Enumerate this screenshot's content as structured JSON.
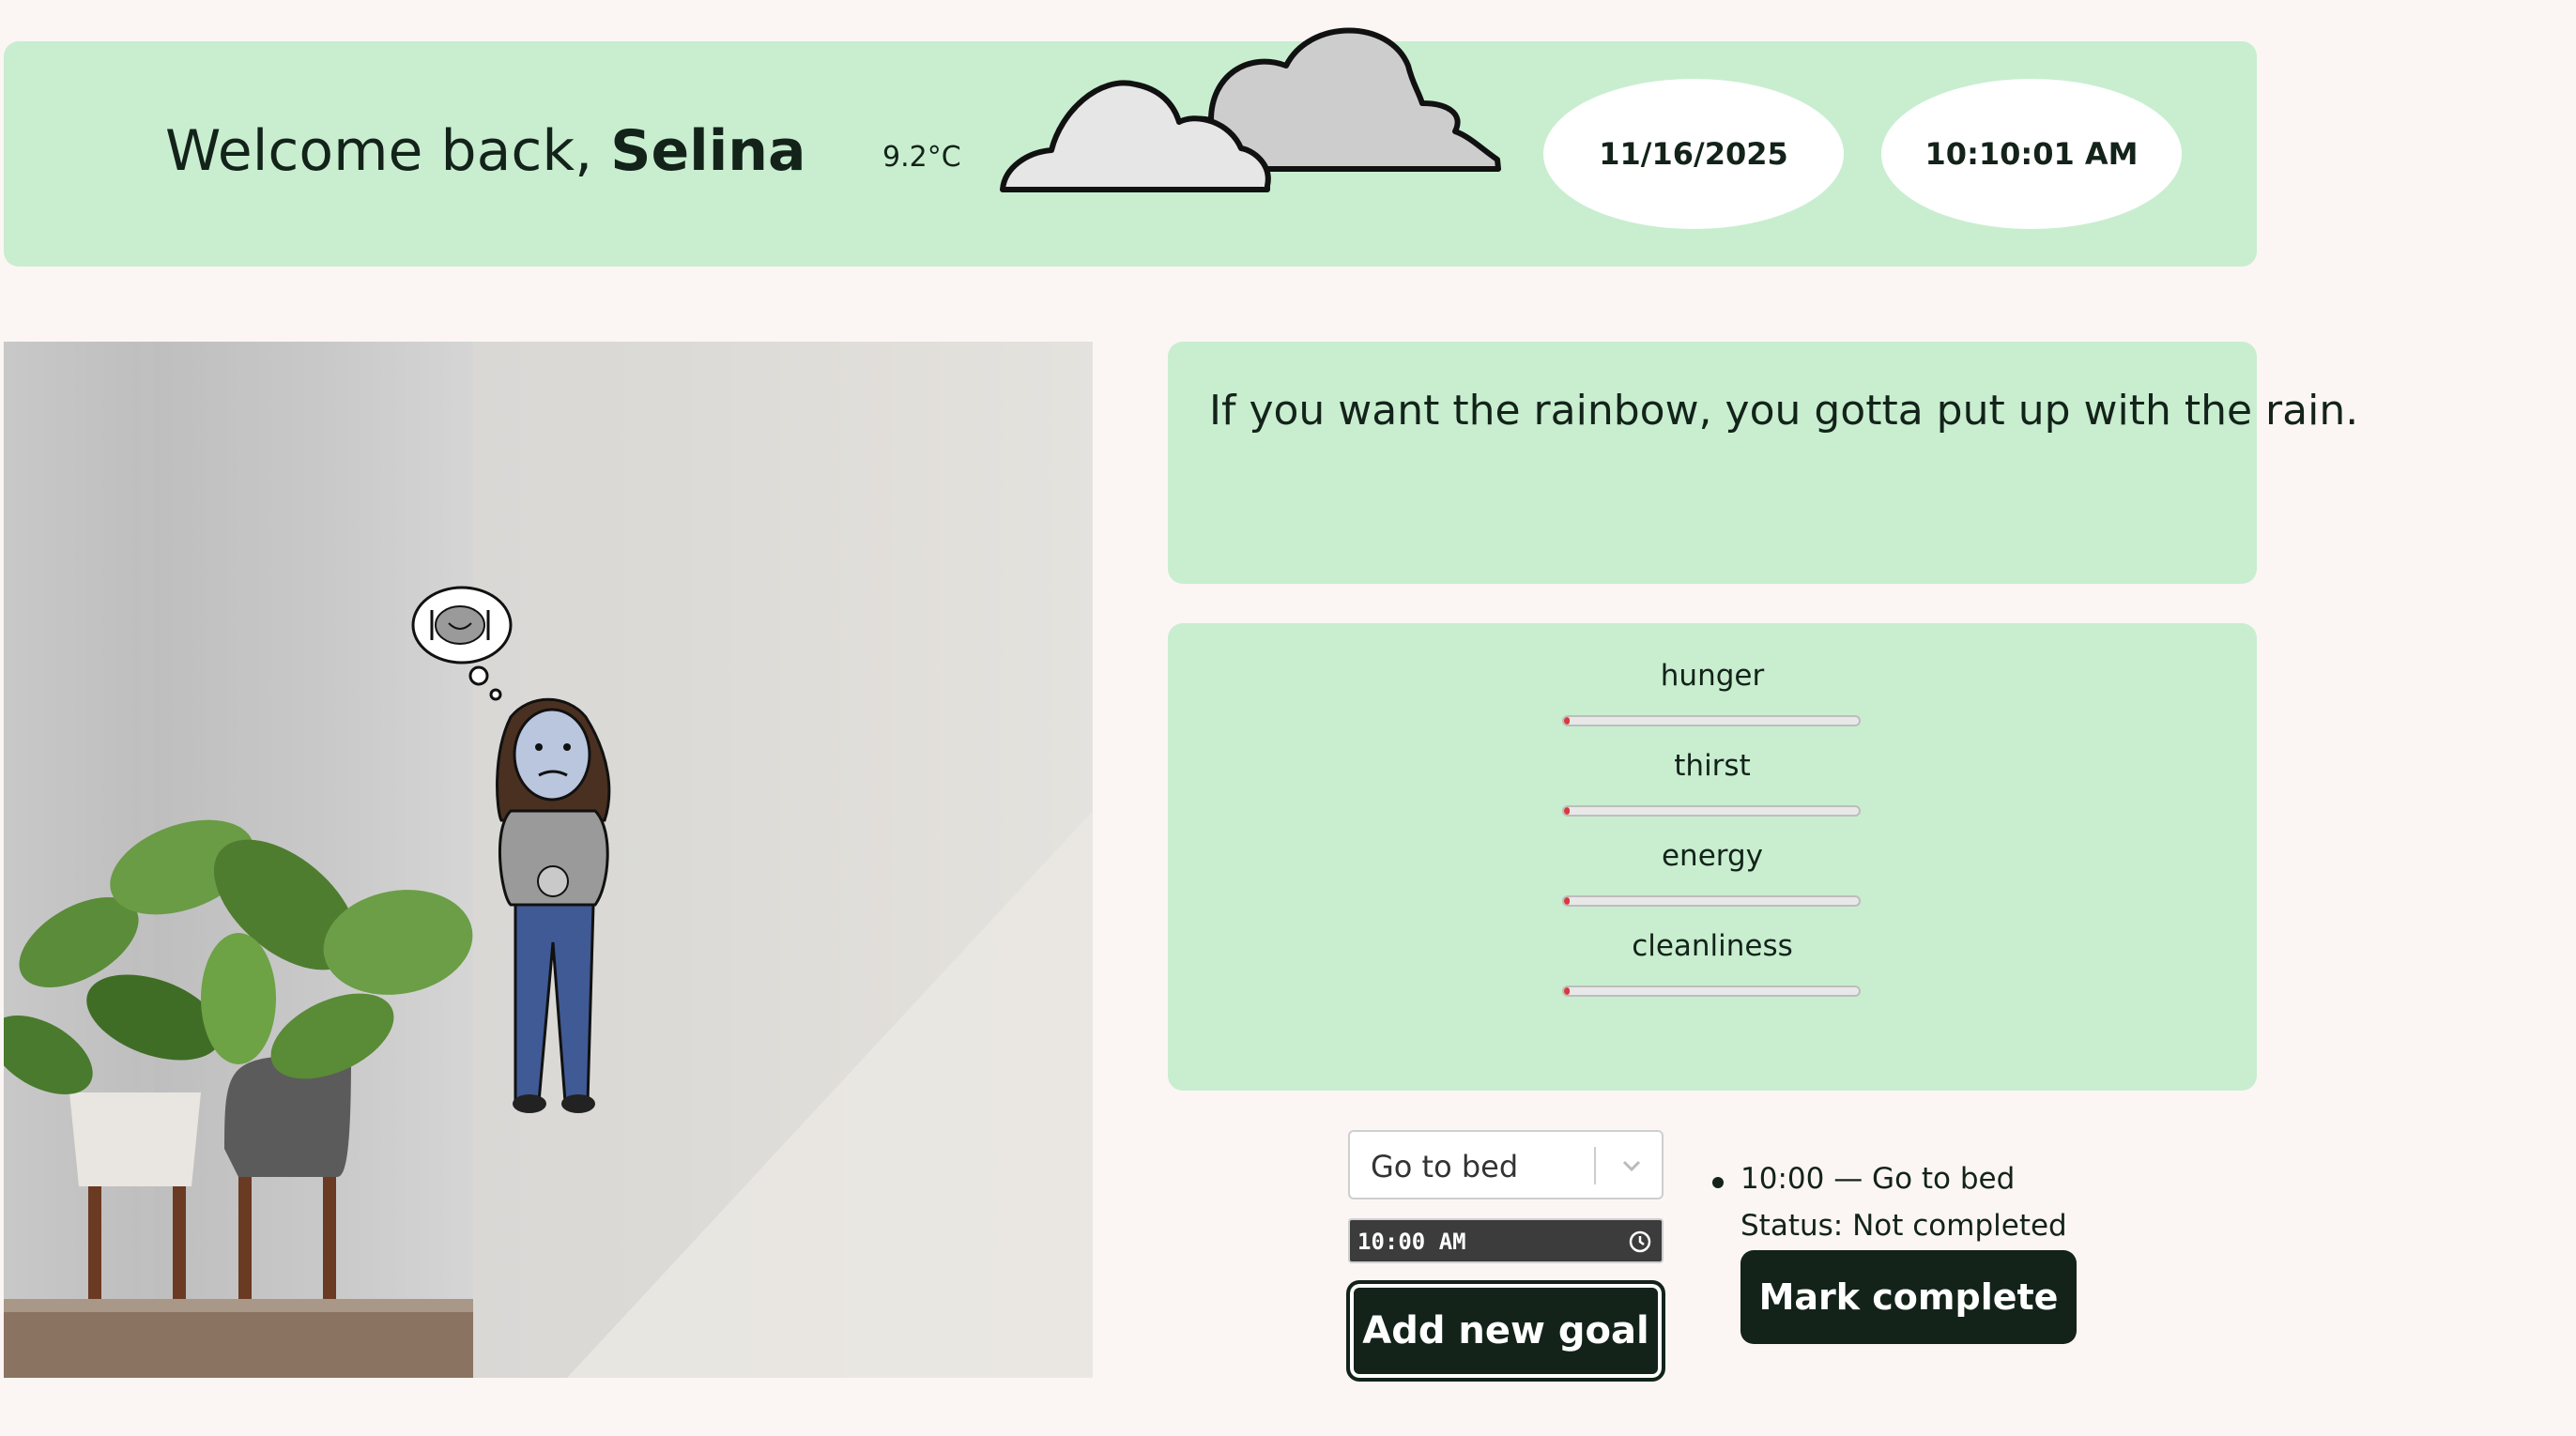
{
  "header": {
    "welcome_prefix": "Welcome back, ",
    "user_name": "Selina",
    "temperature": "9.2°C",
    "weather_icon": "cloudy-icon",
    "date": "11/16/2025",
    "time": "10:10:01 AM"
  },
  "quote": {
    "text": "If you want the rainbow, you gotta put up with the rain."
  },
  "stats": [
    {
      "label": "hunger",
      "level": 0.02
    },
    {
      "label": "thirst",
      "level": 0.02
    },
    {
      "label": "energy",
      "level": 0.02
    },
    {
      "label": "cleanliness",
      "level": 0.02
    }
  ],
  "goals": {
    "select_value": "Go to bed",
    "time_value": "10:00 AM",
    "add_button": "Add new goal",
    "item_text": "10:00 — Go to bed",
    "item_status": "Status: Not completed",
    "mark_button": "Mark complete"
  },
  "colors": {
    "card_green": "#c8eecf",
    "dark": "#13231a",
    "background": "#fbf6f4",
    "stat_fill": "#d93a3a"
  },
  "icons": {
    "thought_bubble": "food-plate-icon",
    "clock": "clock-icon",
    "dropdown": "chevron-down-icon"
  }
}
